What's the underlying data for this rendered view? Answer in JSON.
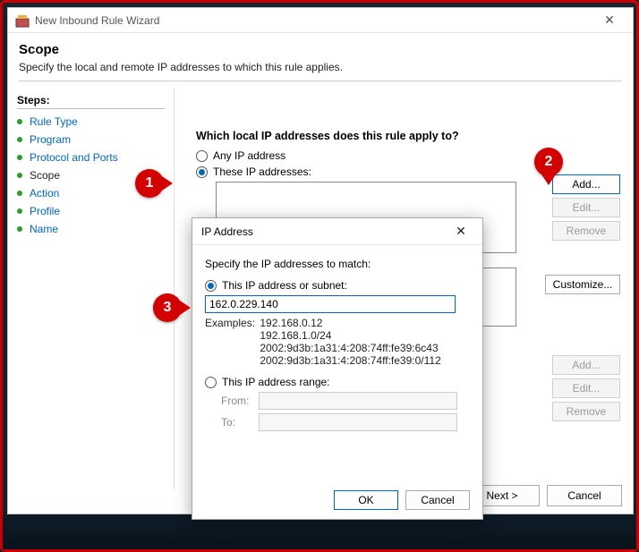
{
  "window": {
    "title": "New Inbound Rule Wizard",
    "close": "✕",
    "scope_title": "Scope",
    "scope_desc": "Specify the local and remote IP addresses to which this rule applies."
  },
  "steps": {
    "title": "Steps:",
    "items": [
      {
        "label": "Rule Type",
        "current": false
      },
      {
        "label": "Program",
        "current": false
      },
      {
        "label": "Protocol and Ports",
        "current": false
      },
      {
        "label": "Scope",
        "current": true
      },
      {
        "label": "Action",
        "current": false
      },
      {
        "label": "Profile",
        "current": false
      },
      {
        "label": "Name",
        "current": false
      }
    ]
  },
  "main": {
    "local_question": "Which local IP addresses does this rule apply to?",
    "any_ip": "Any IP address",
    "these_ip": "These IP addresses:",
    "add": "Add...",
    "edit": "Edit...",
    "remove": "Remove",
    "customize": "Customize...",
    "next": "Next >",
    "cancel": "Cancel"
  },
  "ip_dialog": {
    "title": "IP Address",
    "close": "✕",
    "instruction": "Specify the IP addresses to match:",
    "opt_subnet": "This IP address or subnet:",
    "value": "162.0.229.140",
    "examples_label": "Examples:",
    "ex1": "192.168.0.12",
    "ex2": "192.168.1.0/24",
    "ex3": "2002:9d3b:1a31:4:208:74ff:fe39:6c43",
    "ex4": "2002:9d3b:1a31:4:208:74ff:fe39:0/112",
    "opt_range": "This IP address range:",
    "from": "From:",
    "to": "To:",
    "ok": "OK",
    "cancel": "Cancel"
  },
  "callouts": {
    "c1": "1",
    "c2": "2",
    "c3": "3"
  }
}
